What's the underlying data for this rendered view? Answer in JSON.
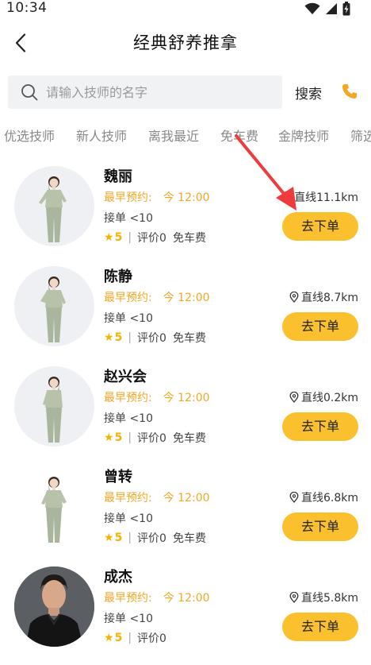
{
  "status_bar": {
    "time": "10:34"
  },
  "header": {
    "title": "经典舒养推拿"
  },
  "search": {
    "placeholder": "请输入技师的名字",
    "value": "",
    "button_label": "搜索"
  },
  "tabs": [
    "优选技师",
    "新人技师",
    "离我最近",
    "免车费",
    "金牌技师",
    "筛选"
  ],
  "therapists": [
    {
      "name": "魏丽",
      "booking_label": "最早预约:",
      "booking_time": "今 12:00",
      "orders": "接单 <10",
      "rating": "5",
      "reviews": "评价0",
      "fee": "免车费",
      "distance": "直线11.1km",
      "button": "去下单",
      "avatar": "woman"
    },
    {
      "name": "陈静",
      "booking_label": "最早预约:",
      "booking_time": "今 12:00",
      "orders": "接单 <10",
      "rating": "5",
      "reviews": "评价0",
      "fee": "免车费",
      "distance": "直线8.7km",
      "button": "去下单",
      "avatar": "woman"
    },
    {
      "name": "赵兴会",
      "booking_label": "最早预约:",
      "booking_time": "今 12:00",
      "orders": "接单 <10",
      "rating": "5",
      "reviews": "评价0",
      "fee": "免车费",
      "distance": "直线0.2km",
      "button": "去下单",
      "avatar": "woman"
    },
    {
      "name": "曾转",
      "booking_label": "最早预约:",
      "booking_time": "今 12:00",
      "orders": "接单 <10",
      "rating": "5",
      "reviews": "评价0",
      "fee": "免车费",
      "distance": "直线6.8km",
      "button": "去下单",
      "avatar": "woman"
    },
    {
      "name": "成杰",
      "booking_label": "最早预约:",
      "booking_time": "今 12:00",
      "orders": "接单 <10",
      "rating": "5",
      "reviews": "评价0",
      "fee": "",
      "distance": "直线5.8km",
      "button": "去下单",
      "avatar": "man"
    }
  ],
  "colors": {
    "accent": "#fbc02d",
    "booking": "#f5a623",
    "annotation_arrow": "#ee3b3b"
  },
  "icons": {
    "back": "chevron-left-icon",
    "search": "search-icon",
    "phone": "phone-icon",
    "location": "location-pin-icon",
    "star": "star-icon"
  }
}
